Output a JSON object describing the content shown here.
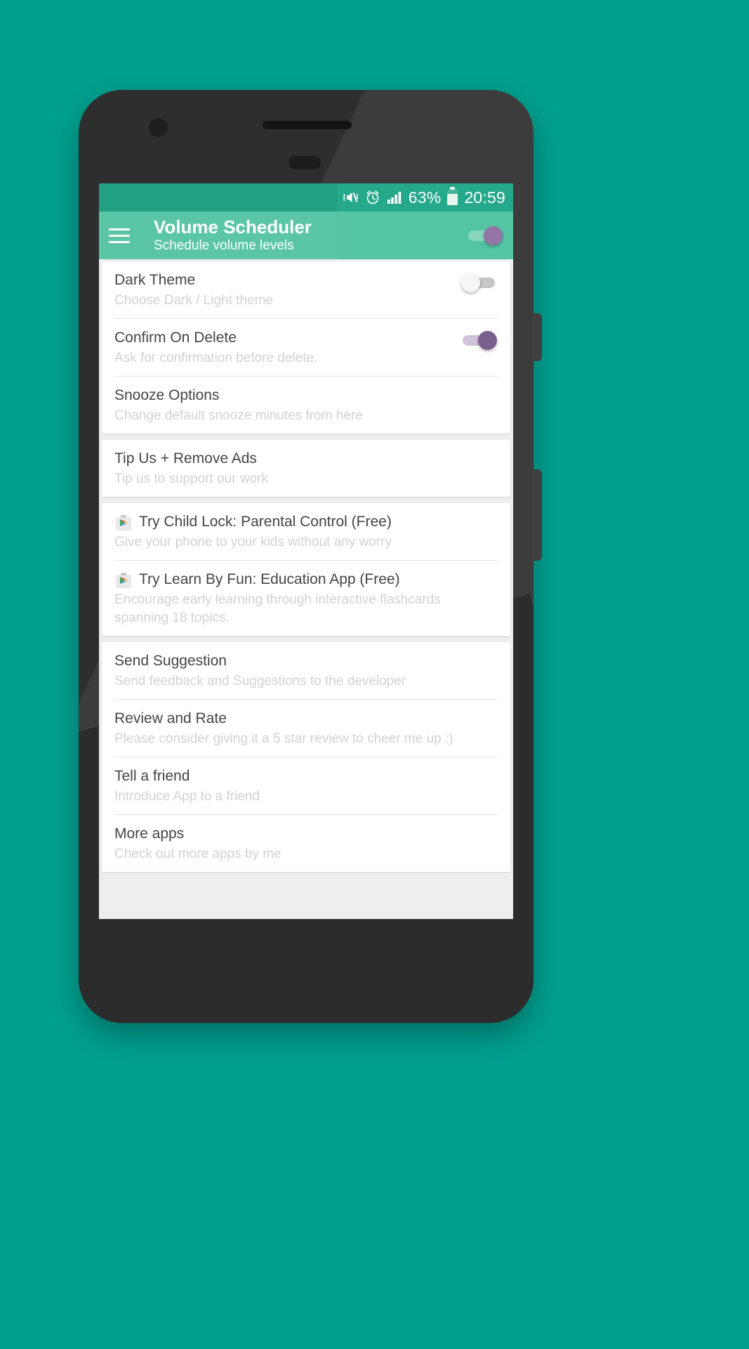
{
  "theme": {
    "page_background": "#009e8e",
    "status_bar_color": "#26a98a",
    "app_bar_color": "#54c4a3",
    "accent_purple": "#7a5e8e",
    "card_background": "#ffffff",
    "content_background": "#eeeeee"
  },
  "status_bar": {
    "vibrate_mute_icon": "volume-mute-vibrate-icon",
    "alarm_icon": "alarm-clock-icon",
    "signal_icon": "signal-bars-icon",
    "battery_percent": "63%",
    "battery_icon": "battery-icon",
    "time": "20:59"
  },
  "app_bar": {
    "menu_icon": "hamburger-menu-icon",
    "title": "Volume Scheduler",
    "subtitle": "Schedule volume levels",
    "master_switch_state": "on"
  },
  "sections": [
    {
      "name": "preferences",
      "rows": [
        {
          "title": "Dark Theme",
          "subtitle": "Choose Dark / Light theme",
          "control": "switch",
          "switch_state": "off"
        },
        {
          "title": "Confirm On Delete",
          "subtitle": "Ask for confirmation before delete.",
          "control": "switch",
          "switch_state": "on"
        },
        {
          "title": "Snooze Options",
          "subtitle": "Change default snooze minutes from here",
          "control": "none"
        }
      ]
    },
    {
      "name": "support",
      "rows": [
        {
          "title": "Tip Us + Remove Ads",
          "subtitle": "Tip us to support our work",
          "control": "none"
        }
      ]
    },
    {
      "name": "promoted-apps",
      "rows": [
        {
          "icon": "google-play-icon",
          "title": "Try Child Lock: Parental Control (Free)",
          "subtitle": "Give your phone to your kids without any worry",
          "control": "none"
        },
        {
          "icon": "google-play-icon",
          "title": "Try Learn By Fun: Education App (Free)",
          "subtitle": "Encourage early learning through interactive flashcards spanning 18 topics.",
          "control": "none"
        }
      ]
    },
    {
      "name": "feedback",
      "rows": [
        {
          "title": "Send Suggestion",
          "subtitle": "Send feedback and Suggestions to the developer",
          "control": "none"
        },
        {
          "title": "Review and Rate",
          "subtitle": "Please consider giving it a 5 star review to cheer me up :)",
          "control": "none"
        },
        {
          "title": "Tell a friend",
          "subtitle": "Introduce App to a friend",
          "control": "none"
        },
        {
          "title": "More apps",
          "subtitle": "Check out more apps by me",
          "control": "none"
        }
      ]
    }
  ]
}
